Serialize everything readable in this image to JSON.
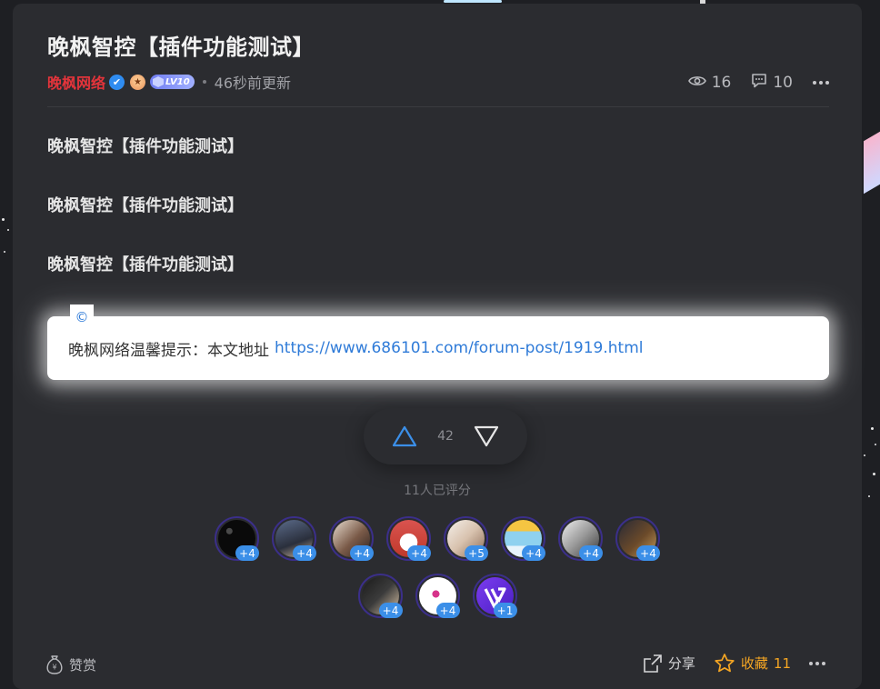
{
  "post": {
    "title": "晚枫智控【插件功能测试】",
    "author": "晚枫网络",
    "verified_icon": "✔",
    "level_label": "LV10",
    "updated": "46秒前更新",
    "views": "16",
    "comments": "10"
  },
  "content": {
    "paragraphs": [
      "晚枫智控【插件功能测试】",
      "晚枫智控【插件功能测试】",
      "晚枫智控【插件功能测试】"
    ]
  },
  "notice": {
    "badge": "©",
    "text": "晚枫网络温馨提示：本文地址",
    "link": "https://www.686101.com/forum-post/1919.html"
  },
  "vote": {
    "count": "42",
    "rated_text": "11人已评分"
  },
  "raters": [
    {
      "plus": "+4"
    },
    {
      "plus": "+4"
    },
    {
      "plus": "+4"
    },
    {
      "plus": "+4"
    },
    {
      "plus": "+5"
    },
    {
      "plus": "+4"
    },
    {
      "plus": "+4"
    },
    {
      "plus": "+4"
    },
    {
      "plus": "+4"
    },
    {
      "plus": "+4"
    },
    {
      "plus": "+1"
    }
  ],
  "footer": {
    "reward": "赞赏",
    "share": "分享",
    "favorite": "收藏",
    "favorite_count": "11"
  },
  "colors": {
    "author": "#e3343b",
    "link": "#2f7bd8",
    "accent_blue": "#3b8fe8",
    "favorite": "#f5a623",
    "card_bg": "#2b2c30"
  },
  "icons": {
    "views": "eye-icon",
    "comments": "comment-icon",
    "more": "more-dots-icon",
    "upvote": "triangle-up-icon",
    "downvote": "triangle-down-icon",
    "reward": "money-bag-icon",
    "share": "share-icon",
    "favorite": "star-icon"
  }
}
